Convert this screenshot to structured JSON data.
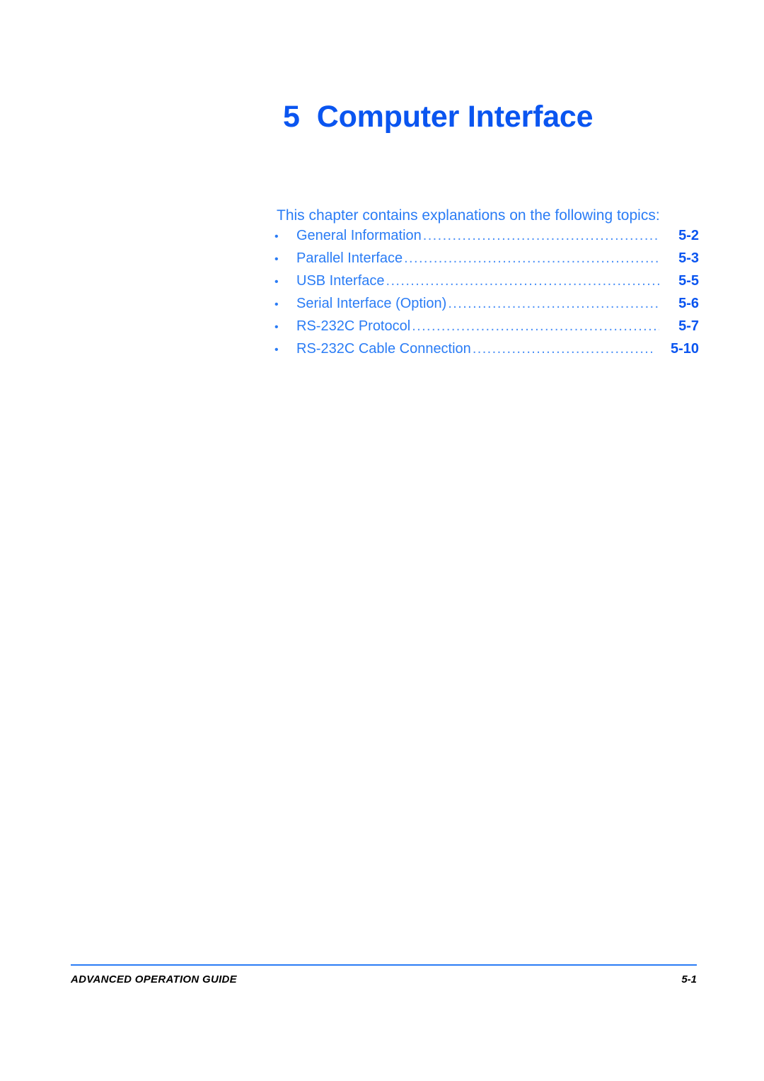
{
  "document": {
    "chapter_number": "5",
    "chapter_title": "Computer Interface",
    "intro_text": "This chapter contains explanations on the following topics:",
    "bullet_glyph": "•",
    "accent_color": "#0a55f0",
    "body_color": "#2a7cf5",
    "footer_color": "#000000"
  },
  "toc": {
    "entries": [
      {
        "label": "General Information",
        "page": "5-2",
        "dots": "..................................................."
      },
      {
        "label": "Parallel Interface",
        "page": "5-3",
        "dots": "........................................................"
      },
      {
        "label": "USB Interface",
        "page": "5-5",
        "dots": "............................................................."
      },
      {
        "label": "Serial Interface (Option)",
        "page": "5-6",
        "dots": ".............................................."
      },
      {
        "label": "RS-232C Protocol",
        "page": "5-7",
        "dots": "......................................................."
      },
      {
        "label": "RS-232C Cable Connection",
        "page": "5-10",
        "dots": "....................................."
      }
    ]
  },
  "footer": {
    "guide_label": "ADVANCED OPERATION GUIDE",
    "page_number": "5-1"
  }
}
